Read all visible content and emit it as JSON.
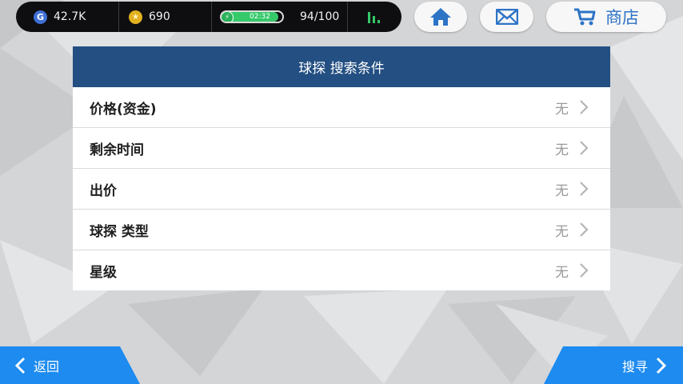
{
  "status_bar": {
    "g_icon_text": "G",
    "g_value": "42.7K",
    "coin_icon_text": "★",
    "coin_value": "690",
    "energy_timer": "02:32",
    "energy_value": "94/100",
    "energy_fill_fraction": 0.94,
    "icons": [
      "g-currency-icon",
      "coin-icon",
      "lightning-icon",
      "stats-icon"
    ]
  },
  "top_buttons": {
    "home_icon": "home-icon",
    "mail_icon": "mail-icon",
    "shop_label": "商店",
    "shop_icon": "cart-icon"
  },
  "panel": {
    "title": "球探 搜索条件",
    "rows": [
      {
        "label": "价格(资金)",
        "value": "无"
      },
      {
        "label": "剩余时间",
        "value": "无"
      },
      {
        "label": "出价",
        "value": "无"
      },
      {
        "label": "球探 类型",
        "value": "无"
      },
      {
        "label": "星级",
        "value": "无"
      }
    ]
  },
  "bottom": {
    "back_label": "返回",
    "search_label": "搜寻"
  },
  "colors": {
    "header": "#234f82",
    "accent_button": "#1d8bf0",
    "shop_text": "#2d73c6",
    "energy": "#35c96a",
    "background": "#d4d5d7"
  }
}
